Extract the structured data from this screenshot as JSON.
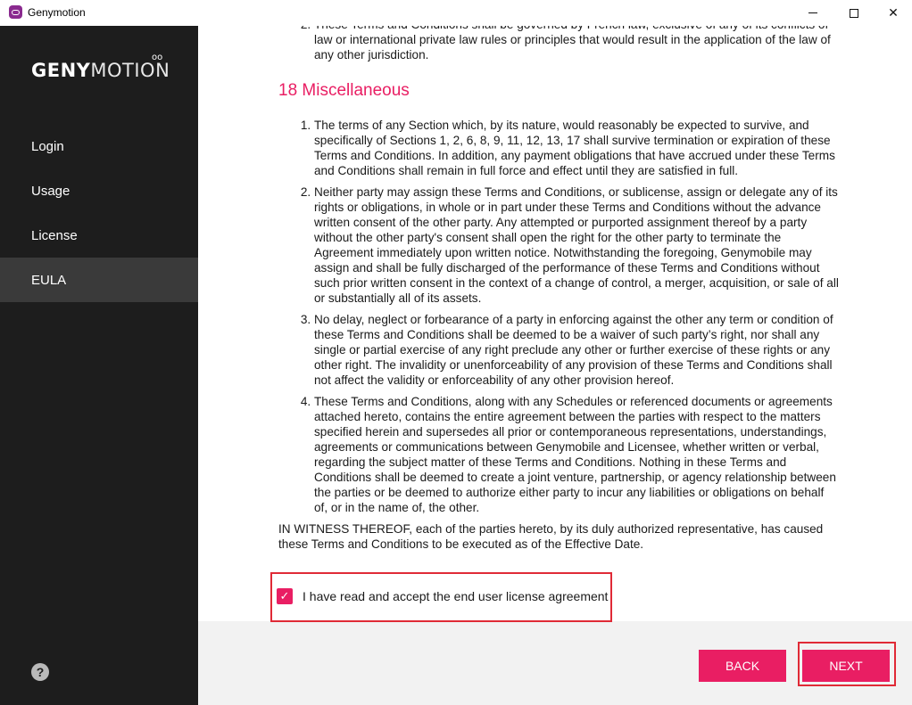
{
  "window": {
    "title": "Genymotion",
    "minimize_glyph": "",
    "close_glyph": "✕"
  },
  "sidebar": {
    "logo_bold": "GENY",
    "logo_light": "MOTION",
    "logo_dots": "oo",
    "items": [
      {
        "label": "Login"
      },
      {
        "label": "Usage"
      },
      {
        "label": "License"
      },
      {
        "label": "EULA"
      }
    ],
    "help_glyph": "?"
  },
  "eula": {
    "prev_item_number": "2.",
    "prev_item_text": "These Terms and Conditions shall be governed by French law, exclusive of any of its conflicts of law or international private law rules or principles that would result in the application of the law of any other jurisdiction.",
    "section_title": "18 Miscellaneous",
    "items": [
      "The terms of any Section which, by its nature, would reasonably be expected to survive, and specifically of Sections 1, 2, 6, 8, 9, 11, 12, 13, 17 shall survive termination or expiration of these Terms and Conditions. In addition, any payment obligations that have accrued under these Terms and Conditions shall remain in full force and effect until they are satisfied in full.",
      "Neither party may assign these Terms and Conditions, or sublicense, assign or delegate any of its rights or obligations, in whole or in part under these Terms and Conditions without the advance written consent of the other party. Any attempted or purported assignment thereof by a party without the other party's consent shall open the right for the other party to terminate the Agreement immediately upon written notice. Notwithstanding the foregoing, Genymobile may assign and shall be fully discharged of the performance of these Terms and Conditions without such prior written consent in the context of a change of control, a merger, acquisition, or sale of all or substantially all of its assets.",
      "No delay, neglect or forbearance of a party in enforcing against the other any term or condition of these Terms and Conditions shall be deemed to be a waiver of such party’s right, nor shall any single or partial exercise of any right preclude any other or further exercise of these rights or any other right. The invalidity or unenforceability of any provision of these Terms and Conditions shall not affect the validity or enforceability of any other provision hereof.",
      "These Terms and Conditions, along with any Schedules or referenced documents or agreements attached hereto, contains the entire agreement between the parties with respect to the matters specified herein and supersedes all prior or contemporaneous representations, understandings, agreements or communications between Genymobile and Licensee, whether written or verbal, regarding the subject matter of these Terms and Conditions. Nothing in these Terms and Conditions shall be deemed to create a joint venture, partnership, or agency relationship between the parties or be deemed to authorize either party to incur any liabilities or obligations on behalf of, or in the name of, the other."
    ],
    "witness": "IN WITNESS THEREOF, each of the parties hereto, by its duly authorized representative, has caused these Terms and Conditions to be executed as of the Effective Date."
  },
  "accept": {
    "checked": true,
    "check_glyph": "✓",
    "label": "I have read and accept the end user license agreement"
  },
  "footer": {
    "back_label": "BACK",
    "next_label": "NEXT"
  },
  "colors": {
    "accent": "#e91e63",
    "sidebar_bg": "#1d1d1d",
    "sidebar_active": "#3a3a3a",
    "highlight": "#e02a36"
  }
}
